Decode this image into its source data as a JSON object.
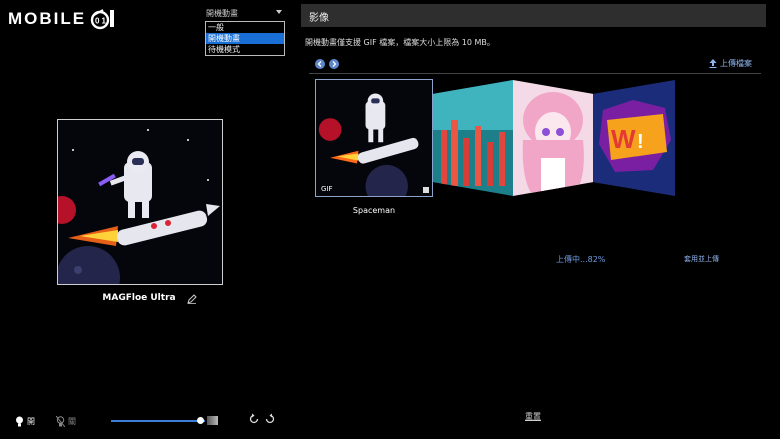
{
  "logo": {
    "text": "MOBILE",
    "badge": "01"
  },
  "dropdown": {
    "selected": "開機動畫",
    "options": [
      "一般",
      "開機動畫",
      "待機模式"
    ],
    "active_index": 1
  },
  "preview": {
    "device_name": "MAGFloe Ultra"
  },
  "controls": {
    "light_on_label": "開",
    "light_off_label": "關",
    "brightness_level": 0.93
  },
  "panel": {
    "title": "影像",
    "hint": "開機動畫僅支援 GIF 檔案，檔案大小上限為 10 MB。",
    "upload_label": "上傳檔案",
    "selected_item": {
      "badge": "GIF",
      "caption": "Spaceman"
    },
    "progress_text": "上傳中...82%",
    "progress_percent": 82,
    "apply_label": "套用並上傳",
    "reset_label": "重置"
  },
  "colors": {
    "accent": "#1a6fd6",
    "link": "#8fb6ee",
    "header_bg": "#2e2e2e"
  }
}
